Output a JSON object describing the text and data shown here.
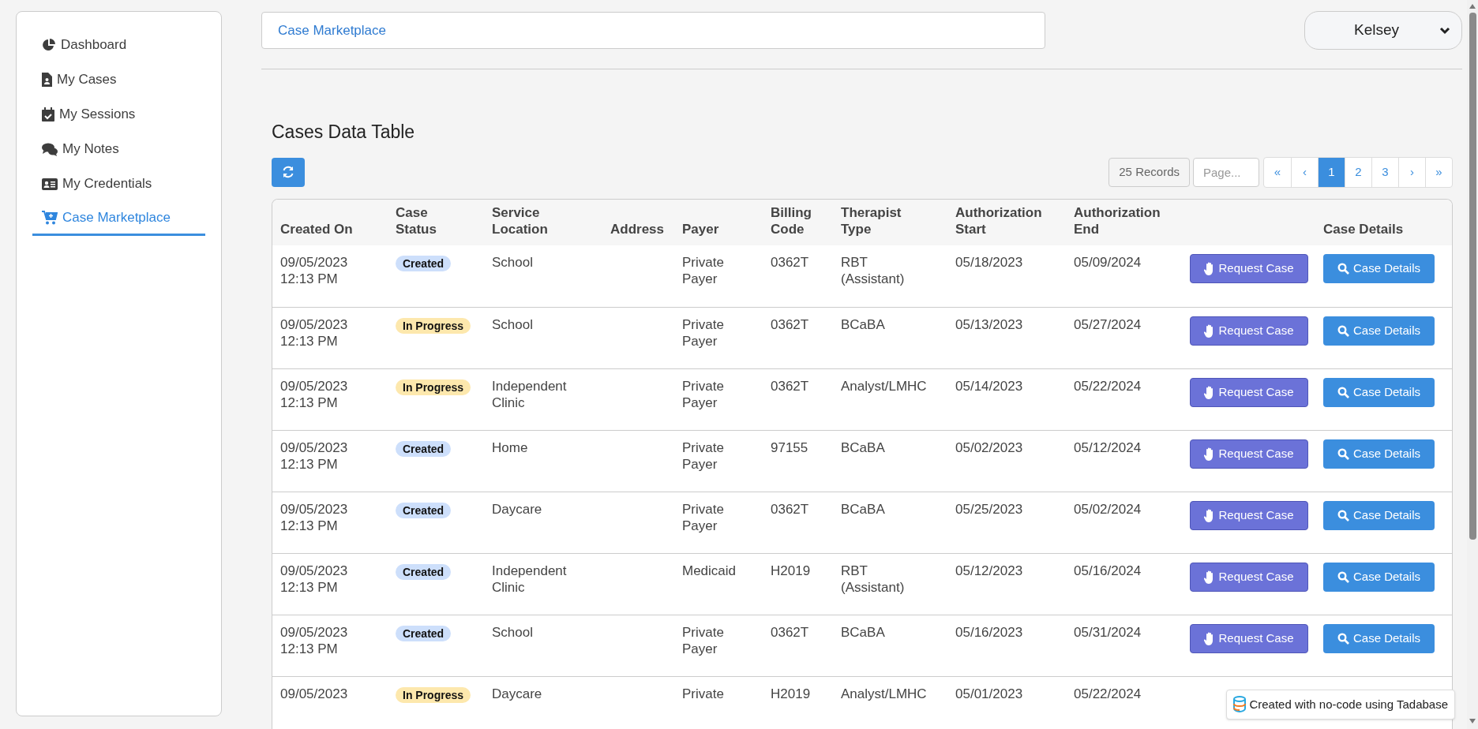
{
  "sidebar": {
    "items": [
      {
        "label": "Dashboard",
        "kind": "pie",
        "selected": false
      },
      {
        "label": "My Cases",
        "kind": "file",
        "selected": false
      },
      {
        "label": "My Sessions",
        "kind": "calendar",
        "selected": false
      },
      {
        "label": "My Notes",
        "kind": "chat",
        "selected": false
      },
      {
        "label": "My Credentials",
        "kind": "card",
        "selected": false
      },
      {
        "label": "Case Marketplace",
        "kind": "cart",
        "selected": true
      }
    ]
  },
  "breadcrumb": "Case Marketplace",
  "user_menu": {
    "label": "Kelsey"
  },
  "title": "Cases Data Table",
  "records": "25 Records",
  "page_field": {
    "placeholder": "Page..."
  },
  "pager": [
    {
      "label": "«",
      "selected": false
    },
    {
      "label": "‹",
      "selected": false
    },
    {
      "label": "1",
      "selected": true
    },
    {
      "label": "2",
      "selected": false
    },
    {
      "label": "3",
      "selected": false
    },
    {
      "label": "›",
      "selected": false
    },
    {
      "label": "»",
      "selected": false
    }
  ],
  "table": {
    "columns": [
      "Created On",
      "Case Status",
      "Service Location",
      "Address",
      "Payer",
      "Billing Code",
      "Therapist Type",
      "Authorization Start",
      "Authorization End",
      "",
      "Case Details"
    ],
    "rows": [
      {
        "date": "09/05/2023",
        "time": "12:13 PM",
        "status": "Created",
        "color": "#cddffb",
        "location": "School",
        "payer": "Private Payer",
        "code": "0362T",
        "therapist": "RBT (Assistant)",
        "start": "05/18/2023",
        "end": "05/09/2024",
        "request": "Request Case",
        "details": "Case Details"
      },
      {
        "date": "09/05/2023",
        "time": "12:13 PM",
        "status": "In Progress",
        "color": "#fde8ad",
        "location": "School",
        "payer": "Private Payer",
        "code": "0362T",
        "therapist": "BCaBA",
        "start": "05/13/2023",
        "end": "05/27/2024",
        "request": "Request Case",
        "details": "Case Details"
      },
      {
        "date": "09/05/2023",
        "time": "12:13 PM",
        "status": "In Progress",
        "color": "#fde8ad",
        "location": "Independent Clinic",
        "payer": "Private Payer",
        "code": "0362T",
        "therapist": "Analyst/LMHC",
        "start": "05/14/2023",
        "end": "05/22/2024",
        "request": "Request Case",
        "details": "Case Details"
      },
      {
        "date": "09/05/2023",
        "time": "12:13 PM",
        "status": "Created",
        "color": "#cddffb",
        "location": "Home",
        "payer": "Private Payer",
        "code": "97155",
        "therapist": "BCaBA",
        "start": "05/02/2023",
        "end": "05/12/2024",
        "request": "Request Case",
        "details": "Case Details"
      },
      {
        "date": "09/05/2023",
        "time": "12:13 PM",
        "status": "Created",
        "color": "#cddffb",
        "location": "Daycare",
        "payer": "Private Payer",
        "code": "0362T",
        "therapist": "BCaBA",
        "start": "05/25/2023",
        "end": "05/02/2024",
        "request": "Request Case",
        "details": "Case Details"
      },
      {
        "date": "09/05/2023",
        "time": "12:13 PM",
        "status": "Created",
        "color": "#cddffb",
        "location": "Independent Clinic",
        "payer": "Medicaid",
        "code": "H2019",
        "therapist": "RBT (Assistant)",
        "start": "05/12/2023",
        "end": "05/16/2024",
        "request": "Request Case",
        "details": "Case Details"
      },
      {
        "date": "09/05/2023",
        "time": "12:13 PM",
        "status": "Created",
        "color": "#cddffb",
        "location": "School",
        "payer": "Private Payer",
        "code": "0362T",
        "therapist": "BCaBA",
        "start": "05/16/2023",
        "end": "05/31/2024",
        "request": "Request Case",
        "details": "Case Details"
      },
      {
        "date": "09/05/2023",
        "status": "In Progress",
        "color": "#fde8ad",
        "location": "Daycare",
        "payer": "Private",
        "code": "H2019",
        "therapist": "Analyst/LMHC",
        "start": "05/01/2023",
        "end": "05/22/2024"
      }
    ]
  },
  "badge": "Created with no-code using Tadabase"
}
